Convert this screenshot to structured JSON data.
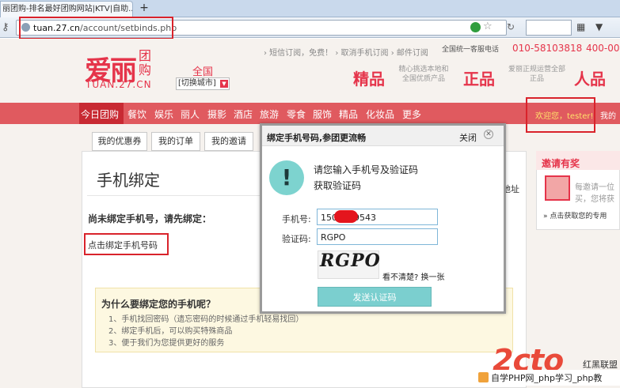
{
  "browser": {
    "tab_title": "丽团购-排名最好团购网站|KTV|自助...",
    "new_tab": "+",
    "url_host": "tuan.27.cn",
    "url_path": "/account/setbinds.php"
  },
  "header": {
    "logo_main": "爱丽",
    "logo_sub1": "团",
    "logo_sub2": "购",
    "logo_domain": "TUAN.27.CN",
    "city": "全国",
    "city_switch": "[切换城市]",
    "top_links": "› 短信订阅，免费！  › 取消手机订阅  › 邮件订阅",
    "hotline_label": "全国统一客服电话",
    "hotline_number": "010-58103818",
    "hotline_number2": "400-00",
    "features": [
      {
        "title": "精品",
        "note": "精心挑选本地和全国优质产品"
      },
      {
        "title": "正品",
        "note": "爱丽正规运营全部正品"
      },
      {
        "title": "人品",
        "note": ""
      }
    ]
  },
  "nav": {
    "items": [
      "今日团购",
      "餐饮",
      "娱乐",
      "丽人",
      "摄影",
      "酒店",
      "旅游",
      "零食",
      "服饰",
      "精品",
      "化妆品",
      "更多"
    ],
    "welcome": "欢迎您，tester!",
    "my_account": "我的"
  },
  "account_tabs": [
    "我的优惠券",
    "我的订单",
    "我的邀请"
  ],
  "main": {
    "title": "手机绑定",
    "not_bound": "尚未绑定手机号，请先绑定：",
    "bind_link": "点击绑定手机号码",
    "address_tail": "地址",
    "why_title": "为什么要绑定您的手机呢？",
    "why_items": [
      "1、手机找回密码（遗忘密码的时候通过手机轻易找回）",
      "2、绑定手机后，可以购买特殊商品",
      "3、便于我们为您提供更好的服务"
    ]
  },
  "sidebar": {
    "title": "邀请有奖",
    "text1": "每邀请一位",
    "text2": "买，您将获",
    "link": "» 点击获取您的专用"
  },
  "modal": {
    "title": "绑定手机号码,参团更流畅",
    "close": "关闭",
    "message_line1": "请您输入手机号及验证码",
    "message_line2": "获取验证码",
    "phone_label": "手机号:",
    "phone_value": "150      9543",
    "code_label": "验证码:",
    "code_value": "RGPO",
    "captcha_text": "RGPO",
    "refresh_captcha": "看不清楚? 换一张",
    "send_button": "发送认证码"
  },
  "watermark": {
    "logo": "2cto",
    "brand": "红黑联盟",
    "line": "自学PHP网_php学习_php教"
  },
  "colors": {
    "brand_red": "#e5344a",
    "nav_bg": "#e05a5f",
    "annotation_red": "#d9232b",
    "send_button": "#7bcfcf"
  }
}
